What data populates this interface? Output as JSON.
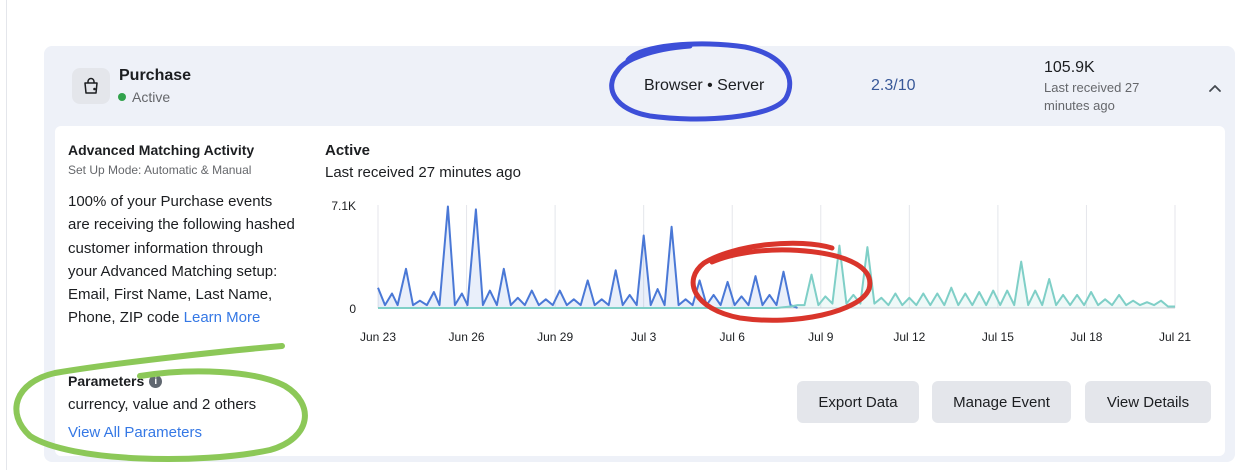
{
  "event": {
    "icon": "shopping-bag-icon",
    "name": "Purchase",
    "status": "Active",
    "connection": "Browser • Server",
    "match_score": "2.3/10",
    "total_events": "105.9K",
    "last_received": "Last received 27 minutes ago"
  },
  "advanced_matching": {
    "title": "Advanced Matching Activity",
    "setup_mode": "Set Up Mode: Automatic & Manual",
    "description": "100% of your Purchase events are receiving the following hashed customer information through your Advanced Matching setup: Email, First Name, Last Name, Phone, ZIP code",
    "learn_more": "Learn More"
  },
  "parameters": {
    "title": "Parameters",
    "summary": "currency, value and 2 others",
    "view_all": "View All Parameters"
  },
  "activity": {
    "status": "Active",
    "last_received": "Last received 27 minutes ago"
  },
  "buttons": {
    "export": "Export Data",
    "manage": "Manage Event",
    "details": "View Details"
  },
  "colors": {
    "browser_series": "#4a78d6",
    "server_series": "#7fcfc7",
    "blue_annotation": "#3d4fd8",
    "red_annotation": "#d9352b",
    "green_annotation": "#8cc858"
  },
  "chart_data": {
    "type": "line",
    "ylim": [
      0,
      7100
    ],
    "y_tick_labels": [
      "7.1K",
      "0"
    ],
    "x_tick_labels": [
      "Jun 23",
      "Jun 26",
      "Jun 29",
      "Jul 3",
      "Jul 6",
      "Jul 9",
      "Jul 12",
      "Jul 15",
      "Jul 18",
      "Jul 21"
    ],
    "grid": true,
    "series": [
      {
        "color": "#4a78d6",
        "points": [
          [
            0,
            1400
          ],
          [
            0.5,
            200
          ],
          [
            1,
            1000
          ],
          [
            1.4,
            200
          ],
          [
            2,
            2700
          ],
          [
            2.5,
            200
          ],
          [
            3,
            500
          ],
          [
            3.5,
            200
          ],
          [
            4,
            1100
          ],
          [
            4.4,
            200
          ],
          [
            5,
            7000
          ],
          [
            5.5,
            200
          ],
          [
            6,
            1000
          ],
          [
            6.4,
            200
          ],
          [
            7,
            6800
          ],
          [
            7.5,
            200
          ],
          [
            8,
            1200
          ],
          [
            8.5,
            200
          ],
          [
            9,
            2700
          ],
          [
            9.5,
            200
          ],
          [
            10,
            700
          ],
          [
            10.5,
            200
          ],
          [
            11,
            1200
          ],
          [
            11.5,
            200
          ],
          [
            12,
            600
          ],
          [
            12.5,
            200
          ],
          [
            13,
            1200
          ],
          [
            13.5,
            200
          ],
          [
            14,
            600
          ],
          [
            14.5,
            200
          ],
          [
            15,
            1900
          ],
          [
            15.5,
            200
          ],
          [
            16,
            600
          ],
          [
            16.5,
            200
          ],
          [
            17,
            2600
          ],
          [
            17.5,
            200
          ],
          [
            18,
            900
          ],
          [
            18.5,
            200
          ],
          [
            19,
            5000
          ],
          [
            19.5,
            200
          ],
          [
            20,
            1300
          ],
          [
            20.5,
            200
          ],
          [
            21,
            5600
          ],
          [
            21.5,
            200
          ],
          [
            22,
            600
          ],
          [
            22.5,
            200
          ],
          [
            23,
            1900
          ],
          [
            23.5,
            200
          ],
          [
            24,
            900
          ],
          [
            24.5,
            200
          ],
          [
            25,
            1800
          ],
          [
            25.5,
            200
          ],
          [
            26,
            800
          ],
          [
            26.5,
            200
          ],
          [
            27,
            2200
          ],
          [
            27.5,
            200
          ],
          [
            28,
            900
          ],
          [
            28.5,
            200
          ],
          [
            29,
            2500
          ],
          [
            29.5,
            200
          ],
          [
            30,
            0
          ]
        ]
      },
      {
        "color": "#7fcfc7",
        "points": [
          [
            0,
            0
          ],
          [
            14,
            0
          ],
          [
            22,
            0
          ],
          [
            23.5,
            0
          ],
          [
            24,
            0
          ],
          [
            27,
            0
          ],
          [
            28.5,
            0
          ],
          [
            29.5,
            100
          ],
          [
            30,
            200
          ],
          [
            30.5,
            200
          ],
          [
            31,
            2300
          ],
          [
            31.5,
            200
          ],
          [
            32,
            800
          ],
          [
            32.5,
            300
          ],
          [
            33,
            4300
          ],
          [
            33.5,
            300
          ],
          [
            34,
            900
          ],
          [
            34.5,
            300
          ],
          [
            35,
            4200
          ],
          [
            35.5,
            300
          ],
          [
            36,
            700
          ],
          [
            36.5,
            200
          ],
          [
            37,
            1000
          ],
          [
            37.5,
            200
          ],
          [
            38,
            700
          ],
          [
            38.5,
            200
          ],
          [
            39,
            1000
          ],
          [
            39.5,
            200
          ],
          [
            40,
            1000
          ],
          [
            40.5,
            200
          ],
          [
            41,
            1400
          ],
          [
            41.5,
            200
          ],
          [
            42,
            1000
          ],
          [
            42.5,
            200
          ],
          [
            43,
            1100
          ],
          [
            43.5,
            200
          ],
          [
            44,
            1200
          ],
          [
            44.5,
            200
          ],
          [
            45,
            1200
          ],
          [
            45.5,
            200
          ],
          [
            46,
            3200
          ],
          [
            46.5,
            200
          ],
          [
            47,
            1200
          ],
          [
            47.5,
            200
          ],
          [
            48,
            2000
          ],
          [
            48.5,
            200
          ],
          [
            49,
            900
          ],
          [
            49.5,
            200
          ],
          [
            50,
            900
          ],
          [
            50.5,
            200
          ],
          [
            51,
            1100
          ],
          [
            51.5,
            200
          ],
          [
            52,
            600
          ],
          [
            52.5,
            200
          ],
          [
            53,
            900
          ],
          [
            53.5,
            200
          ],
          [
            54,
            500
          ],
          [
            54.5,
            200
          ],
          [
            55,
            400
          ],
          [
            55.5,
            200
          ],
          [
            56,
            500
          ],
          [
            56.5,
            100
          ],
          [
            57,
            100
          ]
        ]
      }
    ]
  }
}
